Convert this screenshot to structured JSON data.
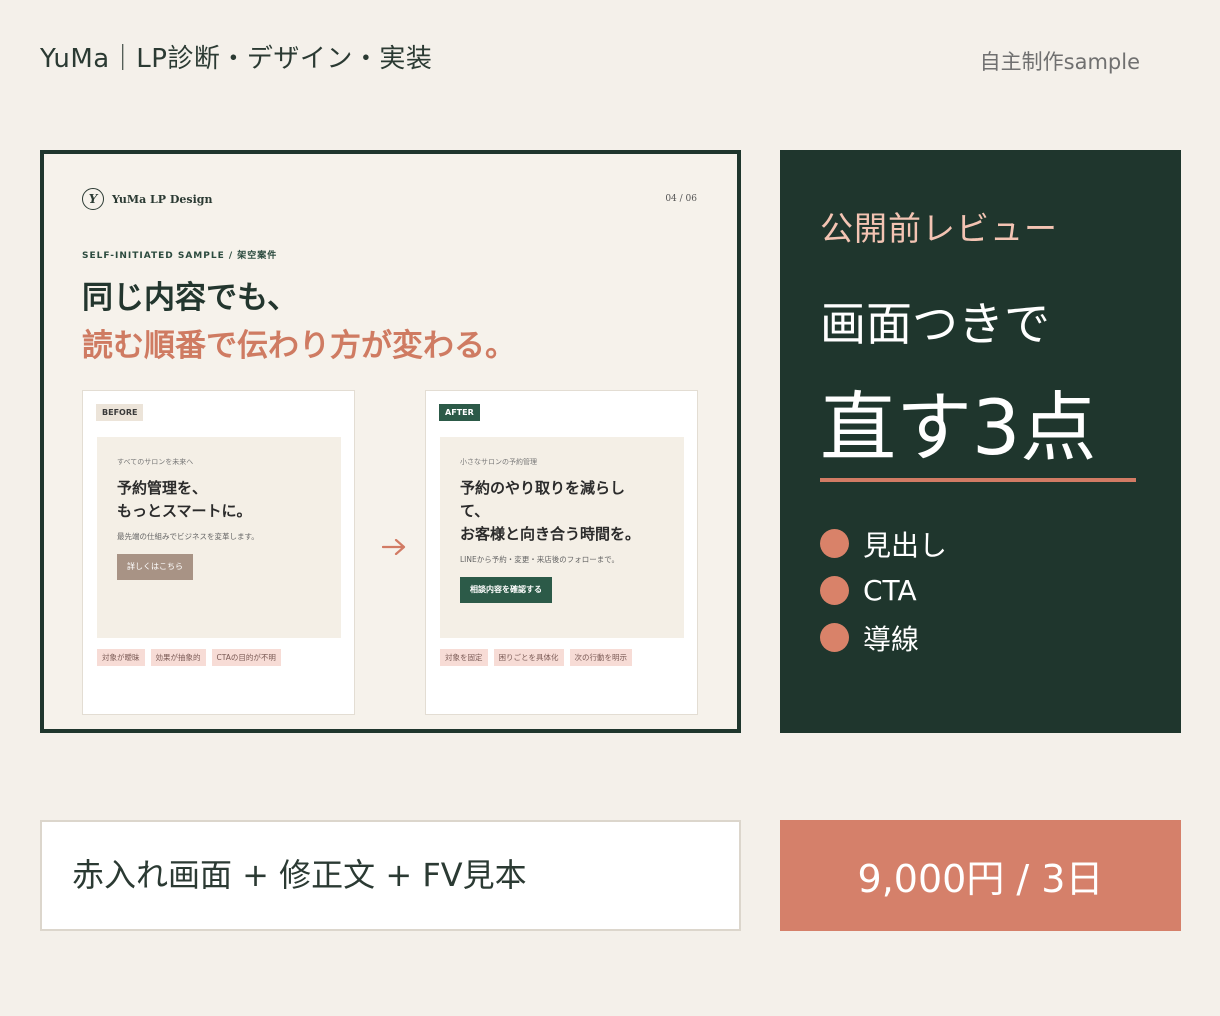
{
  "header": {
    "title": "YuMa｜LP診断・デザイン・実装",
    "tag": "自主制作sample"
  },
  "preview": {
    "logo_mark": "Y",
    "logo_text": "YuMa LP Design",
    "page": "04 / 06",
    "eyebrow": "SELF-INITIATED SAMPLE / 架空案件",
    "headline_line1": "同じ内容でも、",
    "headline_line2": "読む順番で伝わり方が変わる。",
    "before": {
      "badge": "BEFORE",
      "kicker": "すべてのサロンを未来へ",
      "headline": "予約管理を、\nもっとスマートに。",
      "sub": "最先端の仕組みでビジネスを変革します。",
      "button": "詳しくはこちら",
      "chips": [
        "対象が曖昧",
        "効果が抽象的",
        "CTAの目的が不明"
      ]
    },
    "after": {
      "badge": "AFTER",
      "kicker": "小さなサロンの予約管理",
      "headline": "予約のやり取りを減らし\nて、\nお客様と向き合う時間を。",
      "sub": "LINEから予約・変更・来店後のフォローまで。",
      "button": "相談内容を確認する",
      "chips": [
        "対象を固定",
        "困りごとを具体化",
        "次の行動を明示"
      ]
    }
  },
  "review": {
    "label": "公開前レビュー",
    "line1": "画面つきで",
    "line2": "直す3点",
    "items": [
      "見出し",
      "CTA",
      "導線"
    ]
  },
  "deliverables": "赤入れ画面 + 修正文 + FV見本",
  "price": "9,000円 / 3日",
  "colors": {
    "dark_green": "#1f362d",
    "accent": "#d5806a",
    "background": "#f4f0ea"
  }
}
